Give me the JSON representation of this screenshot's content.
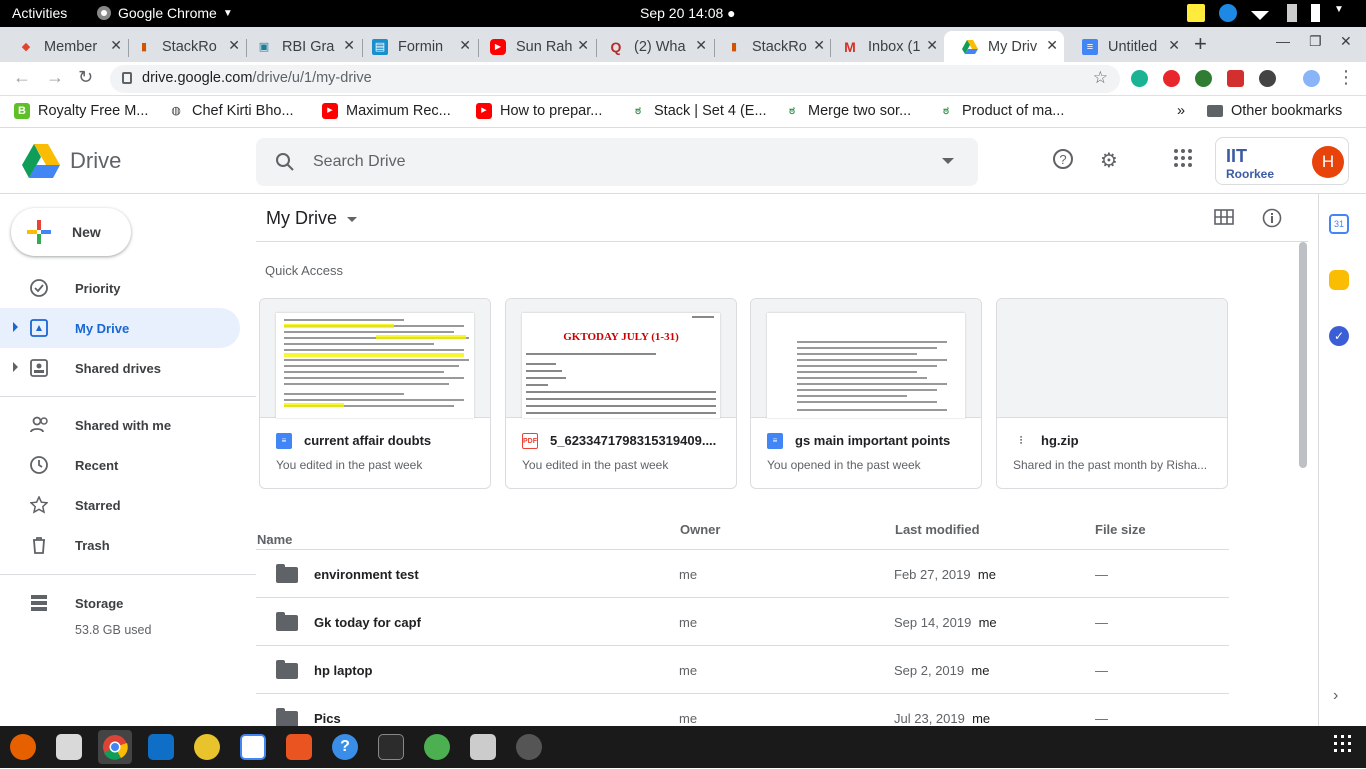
{
  "system": {
    "activities": "Activities",
    "app_name": "Google Chrome",
    "clock": "Sep 20  14:08 ●"
  },
  "browser": {
    "tabs": [
      {
        "label": "Member",
        "icon": "gitlab-icon",
        "color": "#e24329"
      },
      {
        "label": "StackRo",
        "icon": "stackroute-icon",
        "color": "#d35400"
      },
      {
        "label": "RBI Gra",
        "icon": "rbi-icon",
        "color": "#1a7f9a"
      },
      {
        "label": "Formin",
        "icon": "form-icon",
        "color": "#1a8fcc"
      },
      {
        "label": "Sun Rah",
        "icon": "youtube-icon",
        "color": "#ff0000"
      },
      {
        "label": "(2) Wha",
        "icon": "quora-icon",
        "color": "#b92b27"
      },
      {
        "label": "StackRo",
        "icon": "stackroute-icon",
        "color": "#d35400"
      },
      {
        "label": "Inbox (1",
        "icon": "gmail-icon",
        "color": "#d93025"
      },
      {
        "label": "My Driv",
        "icon": "drive-icon",
        "color": "#1a73e8"
      },
      {
        "label": "Untitled",
        "icon": "docs-icon",
        "color": "#4285f4"
      }
    ],
    "url_host": "drive.google.com",
    "url_path": "/drive/u/1/my-drive",
    "bookmarks": [
      "Royalty Free M...",
      "Chef Kirti Bho...",
      "Maximum Rec...",
      "How to prepar...",
      "Stack | Set 4 (E...",
      "Merge two sor...",
      "Product of ma..."
    ],
    "bookmarks_overflow": "»",
    "other_bookmarks": "Other bookmarks"
  },
  "drive": {
    "logo_text": "Drive",
    "search_placeholder": "Search Drive",
    "account_org": "IIT",
    "account_org_sub": "Roorkee",
    "avatar_letter": "H",
    "new_label": "New",
    "nav": [
      "Priority",
      "My Drive",
      "Shared drives",
      "Shared with me",
      "Recent",
      "Starred",
      "Trash"
    ],
    "storage_label": "Storage",
    "storage_used": "53.8 GB used",
    "page_title": "My Drive",
    "quick_access_title": "Quick Access",
    "quick_access": [
      {
        "name": "current affair doubts",
        "sub": "You edited in the past week",
        "type": "docs",
        "badge": ""
      },
      {
        "name": "5_6233471798315319409....",
        "sub": "You edited in the past week",
        "type": "pdf",
        "badge": "PDF"
      },
      {
        "name": "gs main important points",
        "sub": "You opened in the past week",
        "type": "docs",
        "badge": ""
      },
      {
        "name": "hg.zip",
        "sub": "Shared in the past month by Risha...",
        "type": "zip",
        "badge": ""
      }
    ],
    "pdf_preview_title": "GKTODAY JULY (1-31)",
    "columns": {
      "name": "Name",
      "owner": "Owner",
      "modified": "Last modified",
      "size": "File size"
    },
    "files": [
      {
        "name": "environment test",
        "owner": "me",
        "modified": "Feb 27, 2019",
        "modified_by": "me",
        "size": "—"
      },
      {
        "name": "Gk today for capf",
        "owner": "me",
        "modified": "Sep 14, 2019",
        "modified_by": "me",
        "size": "—"
      },
      {
        "name": "hp laptop",
        "owner": "me",
        "modified": "Sep 2, 2019",
        "modified_by": "me",
        "size": "—"
      },
      {
        "name": "Pics",
        "owner": "me",
        "modified": "Jul 23, 2019",
        "modified_by": "me",
        "size": "—"
      }
    ]
  },
  "colors": {
    "accent_blue": "#1a73e8",
    "selected_bg": "#e8f0fe",
    "avatar": "#e8430a"
  }
}
